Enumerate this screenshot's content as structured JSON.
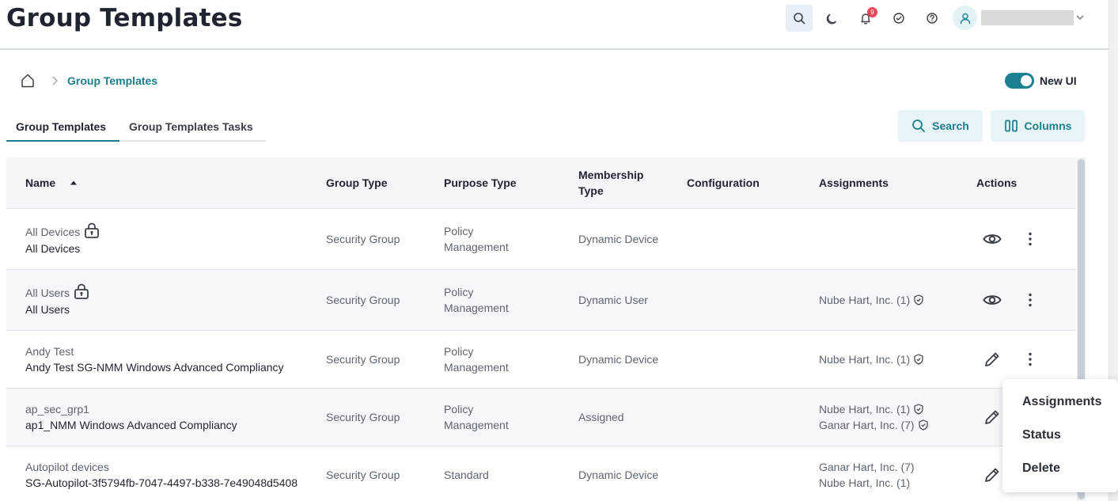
{
  "header": {
    "title": "Group Templates",
    "notification_count": "9"
  },
  "breadcrumb": {
    "current": "Group Templates"
  },
  "toggle": {
    "label": "New UI",
    "on": true
  },
  "tabs": [
    {
      "label": "Group Templates",
      "active": true
    },
    {
      "label": "Group Templates Tasks",
      "active": false
    }
  ],
  "toolbar": {
    "search_label": "Search",
    "columns_label": "Columns"
  },
  "table": {
    "columns": {
      "name": "Name",
      "group_type": "Group Type",
      "purpose_type": "Purpose Type",
      "membership_type_1": "Membership",
      "membership_type_2": "Type",
      "configuration": "Configuration",
      "assignments": "Assignments",
      "actions": "Actions"
    },
    "rows": [
      {
        "name": "All Devices",
        "subname": "All Devices",
        "locked": true,
        "group_type": "Security Group",
        "purpose_1": "Policy",
        "purpose_2": "Management",
        "membership": "Dynamic Device",
        "assign_1": "",
        "assign_2": "",
        "action": "view"
      },
      {
        "name": "All Users",
        "subname": "All Users",
        "locked": true,
        "group_type": "Security Group",
        "purpose_1": "Policy",
        "purpose_2": "Management",
        "membership": "Dynamic User",
        "assign_1": "Nube Hart, Inc. (1)",
        "assign_2": "",
        "action": "view"
      },
      {
        "name": "Andy Test",
        "subname": "Andy Test SG-NMM Windows Advanced Compliancy",
        "locked": false,
        "group_type": "Security Group",
        "purpose_1": "Policy",
        "purpose_2": "Management",
        "membership": "Dynamic Device",
        "assign_1": "Nube Hart, Inc. (1)",
        "assign_2": "",
        "action": "edit"
      },
      {
        "name": "ap_sec_grp1",
        "subname": "ap1_NMM Windows Advanced Compliancy",
        "locked": false,
        "group_type": "Security Group",
        "purpose_1": "Policy",
        "purpose_2": "Management",
        "membership": "Assigned",
        "assign_1": "Nube Hart, Inc. (1)",
        "assign_2": "Ganar Hart, Inc. (7)",
        "action": "edit"
      },
      {
        "name": "Autopilot devices",
        "subname": "SG-Autopilot-3f5794fb-7047-4497-b338-7e49048d5408",
        "locked": false,
        "group_type": "Security Group",
        "purpose_1": "Standard",
        "purpose_2": "",
        "membership": "Dynamic Device",
        "assign_1": "Ganar Hart, Inc. (7)",
        "assign_2": "Nube Hart, Inc. (1)",
        "action": "edit"
      }
    ]
  },
  "context_menu": {
    "items": [
      "Assignments",
      "Status",
      "Delete"
    ]
  },
  "colors": {
    "accent": "#1d7d8c",
    "badge": "#e8485a",
    "header_bg": "#f3f5f9"
  }
}
